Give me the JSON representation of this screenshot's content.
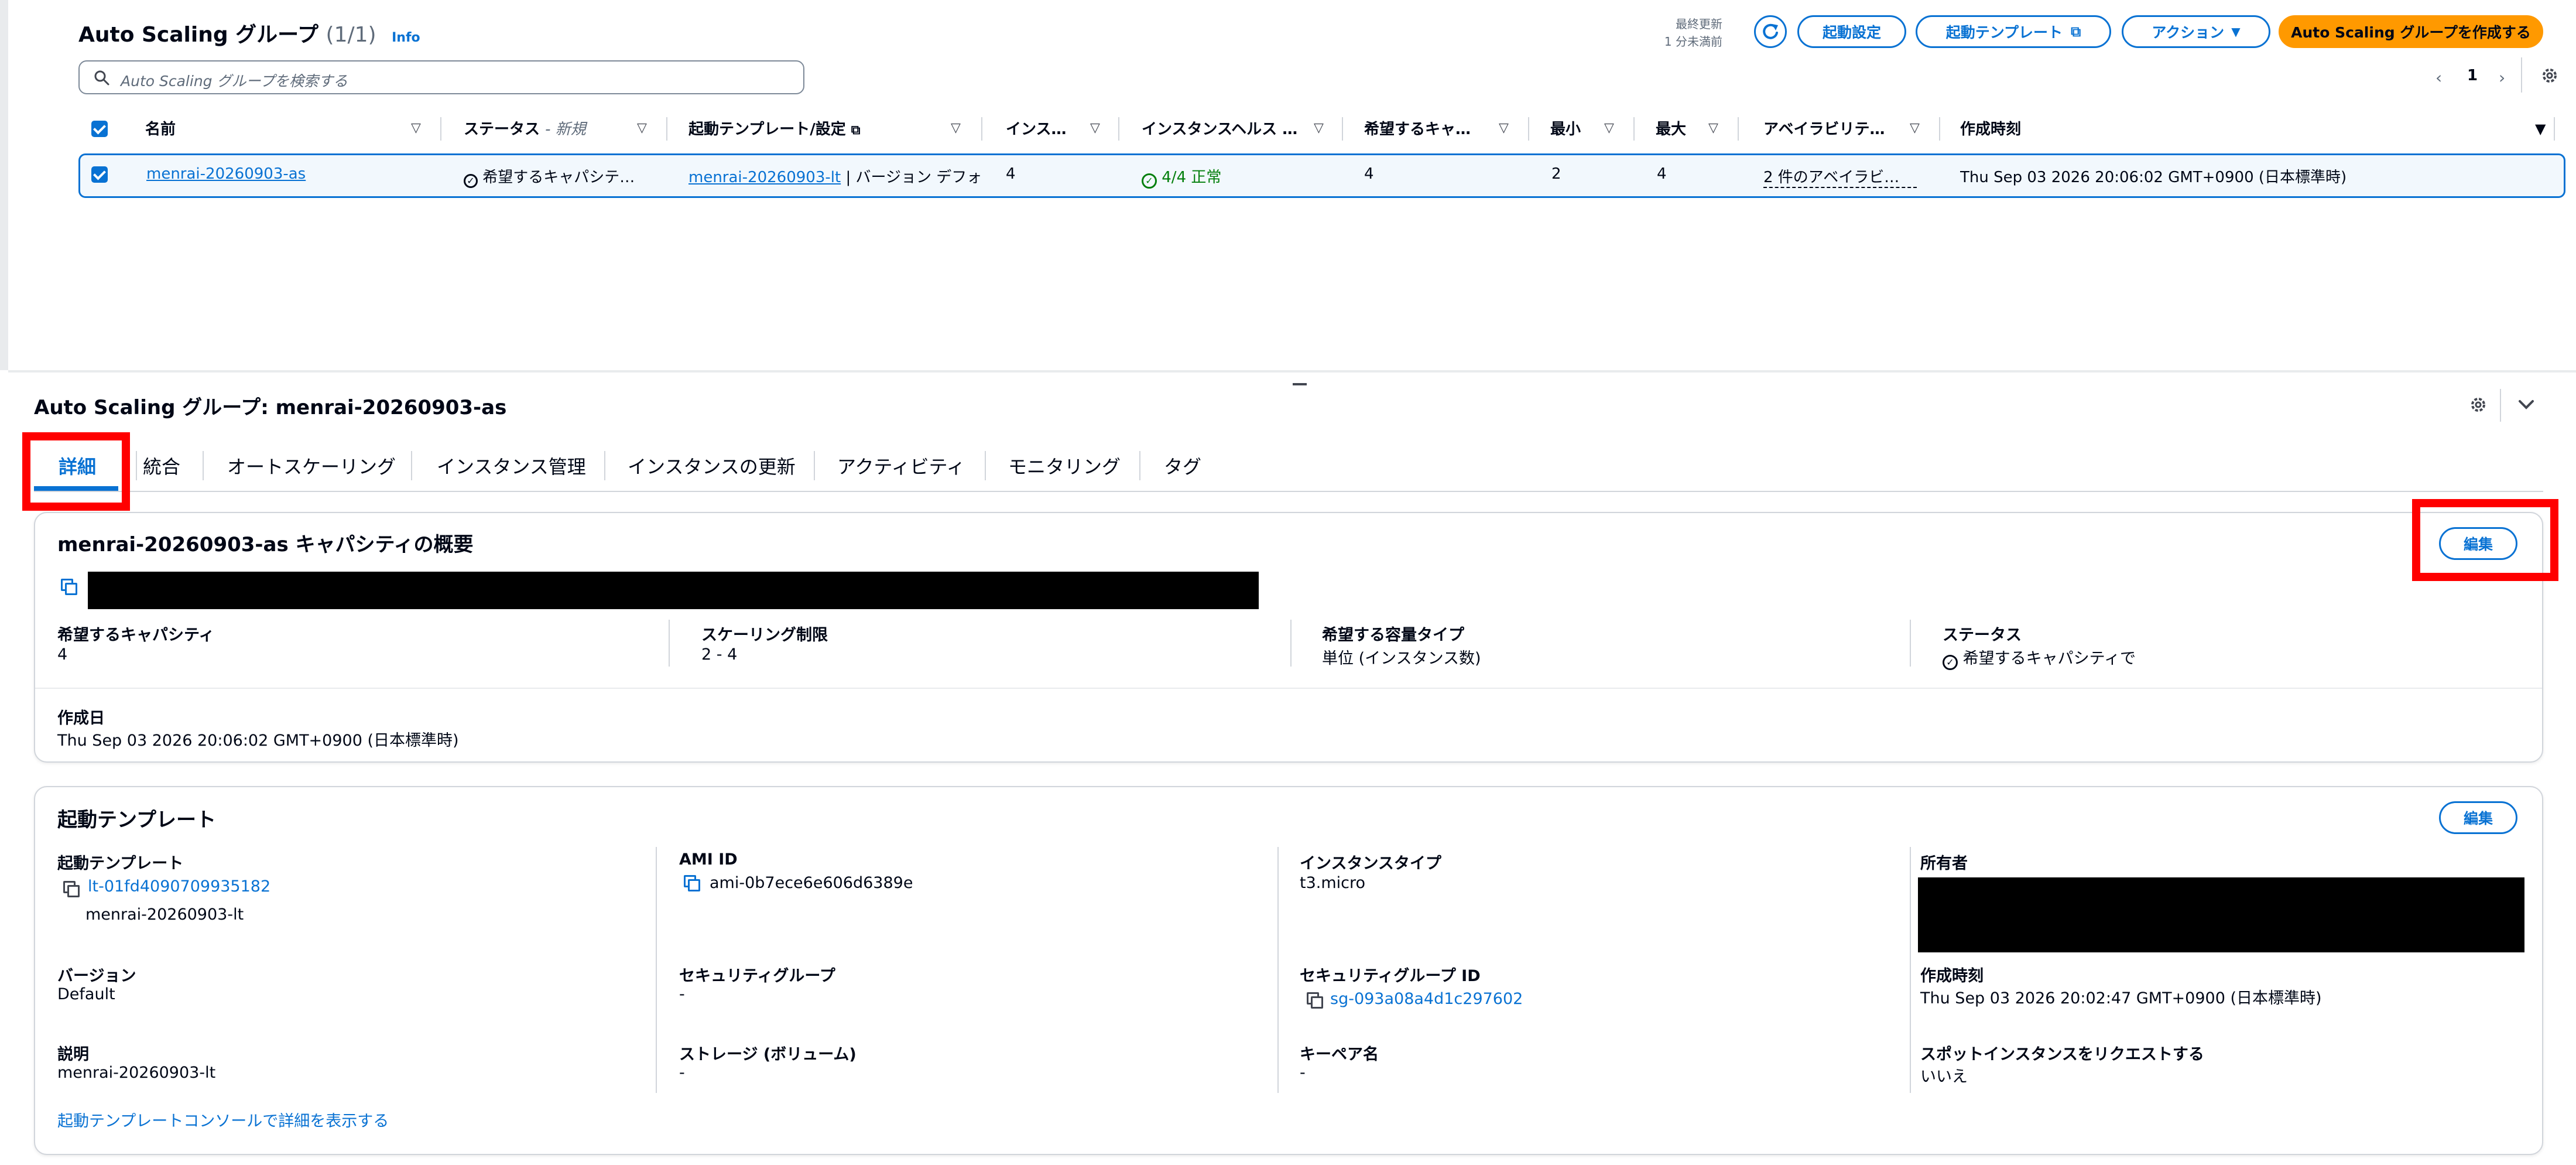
{
  "list": {
    "title": "Auto Scaling グループ",
    "count": "(1/1)",
    "info": "Info",
    "last_updated_label": "最終更新",
    "last_updated_value": "1 分未満前",
    "buttons": {
      "launch_config": "起動設定",
      "launch_template": "起動テンプレート",
      "actions": "アクション",
      "create": "Auto Scaling グループを作成する"
    },
    "search_placeholder": "Auto Scaling グループを検索する",
    "page": "1",
    "columns": {
      "name": "名前",
      "status": "ステータス",
      "status_new": "- 新規",
      "launch_template": "起動テンプレート/設定",
      "instances": "インス…",
      "instance_health": "インスタンスヘルス …",
      "desired": "希望するキャ…",
      "min": "最小",
      "max": "最大",
      "az": "アベイラビリテ…",
      "created": "作成時刻"
    },
    "row": {
      "name": "menrai-20260903-as",
      "status": "希望するキャパシテ…",
      "launch_template": "menrai-20260903-lt",
      "launch_template_version": "| バージョン デフォル",
      "instances": "4",
      "health": "4/4 正常",
      "desired": "4",
      "min": "2",
      "max": "4",
      "az": "2 件のアベイラビ…",
      "created": "Thu Sep 03 2026 20:06:02 GMT+0900 (日本標準時)"
    }
  },
  "detail": {
    "title": "Auto Scaling グループ: menrai-20260903-as",
    "tabs": [
      "詳細",
      "統合",
      "オートスケーリング",
      "インスタンス管理",
      "インスタンスの更新",
      "アクティビティ",
      "モニタリング",
      "タグ"
    ],
    "capacity": {
      "title": "menrai-20260903-as キャパシティの概要",
      "edit": "編集",
      "desired_label": "希望するキャパシティ",
      "desired_value": "4",
      "scaling_label": "スケーリング制限",
      "scaling_value": "2 - 4",
      "capacity_type_label": "希望する容量タイプ",
      "capacity_type_value": "単位 (インスタンス数)",
      "status_label": "ステータス",
      "status_value": "希望するキャパシティで",
      "created_label": "作成日",
      "created_value": "Thu Sep 03 2026 20:06:02 GMT+0900 (日本標準時)"
    },
    "launch_template": {
      "title": "起動テンプレート",
      "edit": "編集",
      "lt_label": "起動テンプレート",
      "lt_id": "lt-01fd4090709935182",
      "lt_name": "menrai-20260903-lt",
      "ami_label": "AMI ID",
      "ami_value": "ami-0b7ece6e606d6389e",
      "instance_type_label": "インスタンスタイプ",
      "instance_type_value": "t3.micro",
      "owner_label": "所有者",
      "version_label": "バージョン",
      "version_value": "Default",
      "sg_label": "セキュリティグループ",
      "sg_value": "-",
      "sg_id_label": "セキュリティグループ ID",
      "sg_id_value": "sg-093a08a4d1c297602",
      "created_label": "作成時刻",
      "created_value": "Thu Sep 03 2026 20:02:47 GMT+0900 (日本標準時)",
      "desc_label": "説明",
      "desc_value": "menrai-20260903-lt",
      "storage_label": "ストレージ (ボリューム)",
      "storage_value": "-",
      "keypair_label": "キーペア名",
      "keypair_value": "-",
      "spot_label": "スポットインスタンスをリクエストする",
      "spot_value": "いいえ",
      "console_link": "起動テンプレートコンソールで詳細を表示する"
    }
  },
  "colors": {
    "accent": "#0972d3",
    "primary_button": "#ff9900",
    "success": "#037f0c",
    "highlight_box": "#ff0000"
  }
}
